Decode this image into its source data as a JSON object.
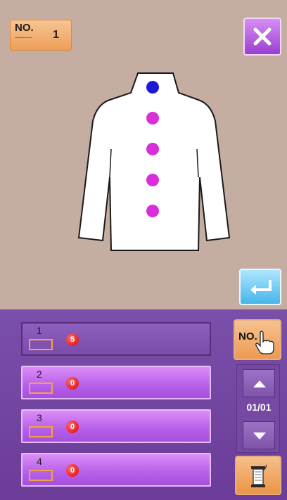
{
  "header": {
    "no_label": "NO.",
    "pattern_number": "1"
  },
  "buttons": {
    "close_icon": "close-icon",
    "enter_icon": "enter-return-icon",
    "no_select_label": "NO.",
    "thread_icon": "thread-spool-icon"
  },
  "garment": {
    "top_button_color": "#1a1ad6",
    "button_color": "#d92ed9",
    "button_count": 5
  },
  "list": {
    "rows": [
      {
        "number": "1",
        "count": "5",
        "state": "inactive"
      },
      {
        "number": "2",
        "count": "0",
        "state": "active"
      },
      {
        "number": "3",
        "count": "0",
        "state": "active"
      },
      {
        "number": "4",
        "count": "0",
        "state": "active"
      }
    ]
  },
  "pager": {
    "page": "01/01"
  }
}
